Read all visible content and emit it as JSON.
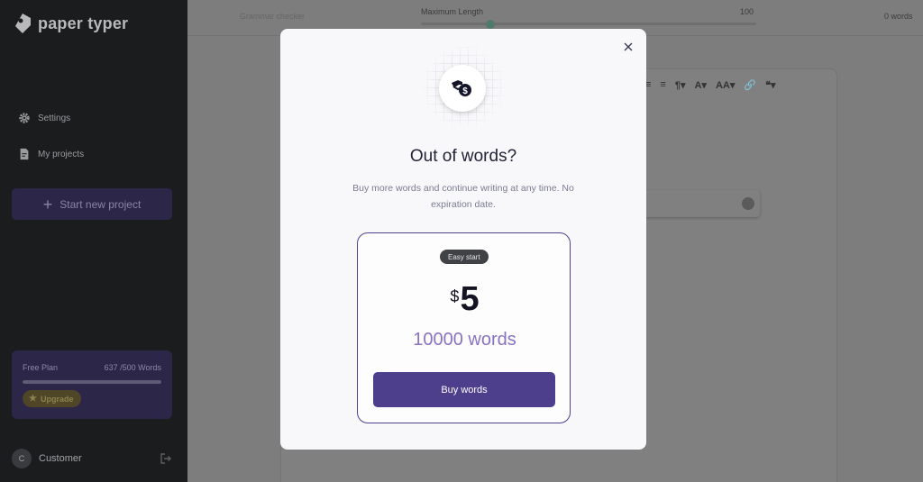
{
  "brand": {
    "name": "paper typer"
  },
  "sidebar": {
    "items": [
      {
        "label": "Settings",
        "icon": "gear-icon"
      },
      {
        "label": "My projects",
        "icon": "document-icon"
      }
    ],
    "new_project_label": "Start new project",
    "plan": {
      "name": "Free Plan",
      "usage_text": "637 /500  Words",
      "usage_fraction": 1.0,
      "upgrade_label": "Upgrade"
    },
    "user": {
      "initial": "C",
      "name": "Customer"
    }
  },
  "topbar": {
    "grammar_tab": "Grammar checker",
    "max_length_label": "Maximum Length",
    "max_length_value": "100",
    "word_count": "0 words"
  },
  "toolbar": {
    "items": [
      "≡",
      "≡",
      "¶▾",
      "A▾",
      "AA▾",
      "🔗",
      "❝▾"
    ]
  },
  "modal": {
    "title": "Out of words?",
    "description": "Buy more words and continue writing at any time. No expiration date.",
    "offer": {
      "badge": "Easy start",
      "currency": "$",
      "amount": "5",
      "words": "10000 words",
      "button_label": "Buy words"
    }
  },
  "colors": {
    "accent": "#4e3f8c",
    "accent_light": "#8773c2",
    "sidebar_bg": "#1b1c1e"
  }
}
